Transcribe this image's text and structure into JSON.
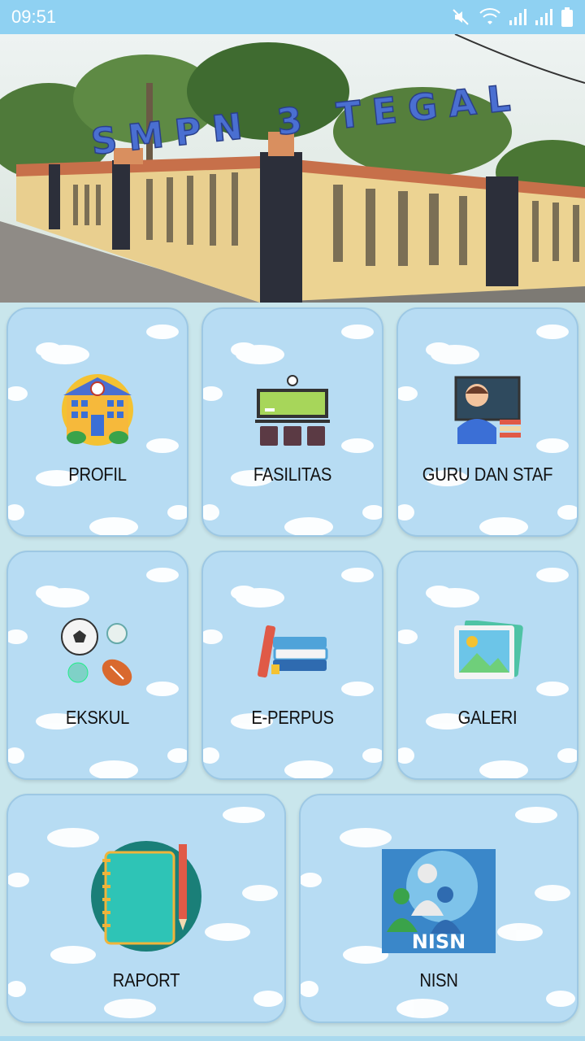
{
  "status_bar": {
    "time": "09:51"
  },
  "banner": {
    "sign_text": "SMPN 3 TEGAL"
  },
  "menu": {
    "profil": "PROFIL",
    "fasilitas": "FASILITAS",
    "guru": "GURU DAN STAF",
    "ekskul": "EKSKUL",
    "eperpus": "E-PERPUS",
    "galeri": "GALERI",
    "raport": "RAPORT",
    "nisn": "NISN",
    "nisn_logo_text": "NISN"
  },
  "colors": {
    "status_bar": "#8fd1f2",
    "tile_bg": "#b7dcf3",
    "page_bg": "#c9e6ec"
  }
}
